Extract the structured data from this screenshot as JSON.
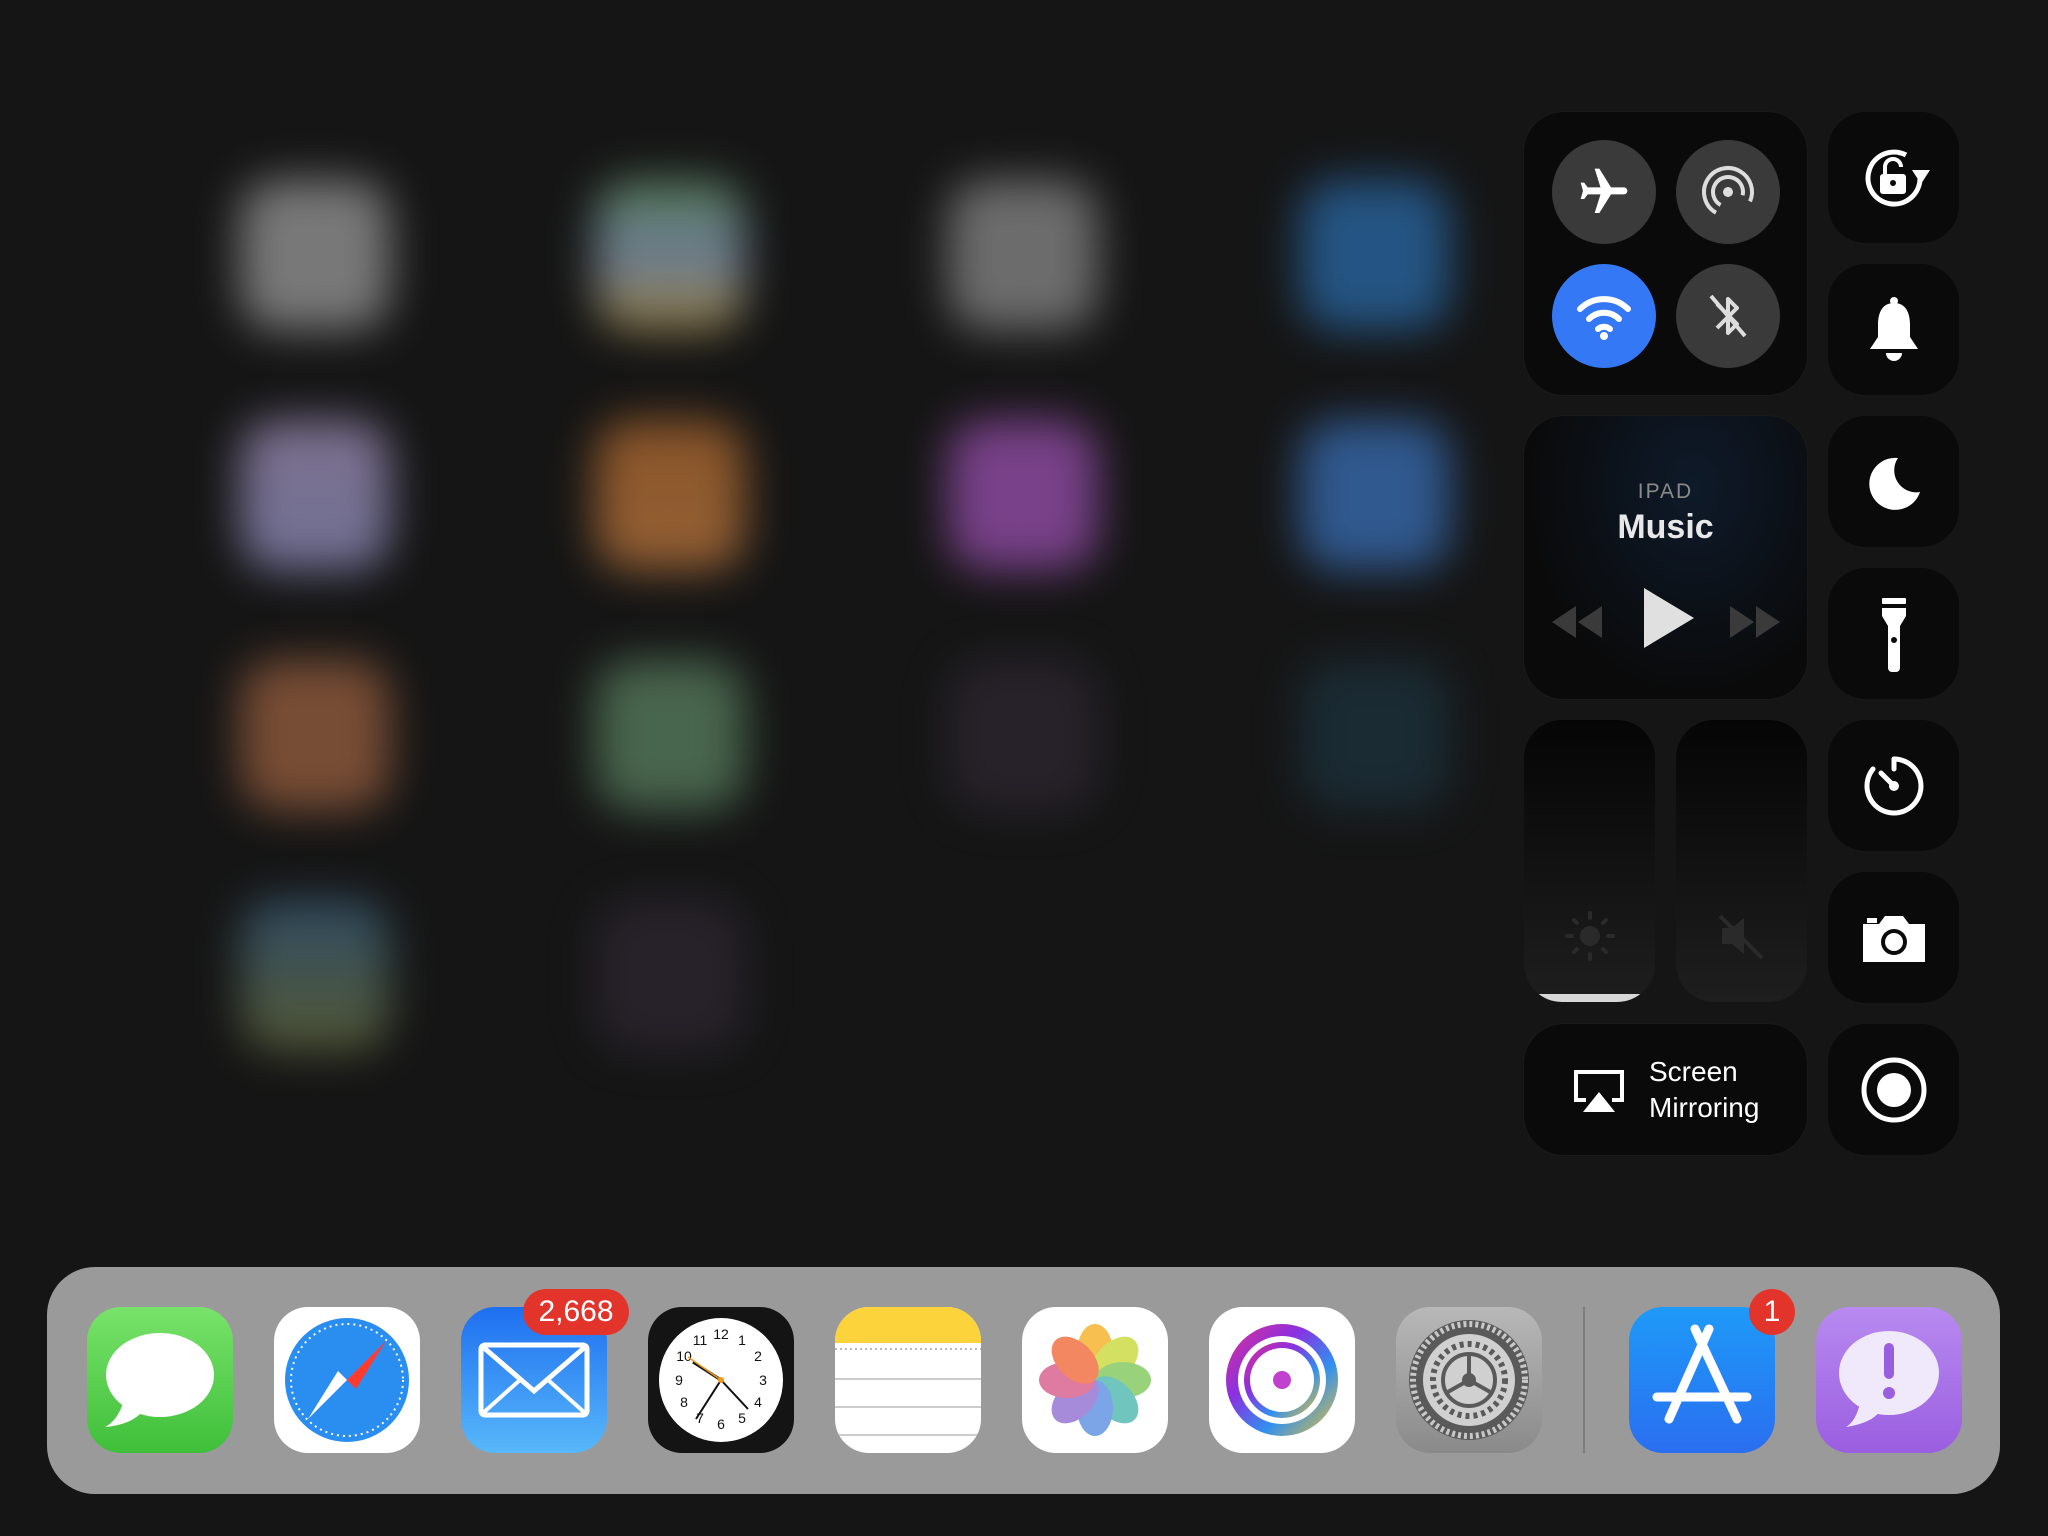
{
  "control_center": {
    "connectivity": {
      "airplane": {
        "icon": "airplane-icon",
        "on": false
      },
      "airdrop": {
        "icon": "airdrop-icon",
        "on": false
      },
      "wifi": {
        "icon": "wifi-icon",
        "on": true
      },
      "bluetooth": {
        "icon": "bluetooth-off-icon",
        "on": false
      }
    },
    "music": {
      "source": "IPAD",
      "title": "Music",
      "controls": [
        "rewind-icon",
        "play-icon",
        "fast-forward-icon"
      ]
    },
    "brightness": {
      "icon": "brightness-icon",
      "level": 0.03
    },
    "volume": {
      "icon": "mute-icon",
      "level": 0.0
    },
    "screen_mirroring": {
      "line1": "Screen",
      "line2": "Mirroring",
      "icon": "airplay-icon"
    },
    "side_buttons": [
      {
        "name": "orientation-lock",
        "icon": "rotation-lock-icon"
      },
      {
        "name": "silent-mode",
        "icon": "bell-icon"
      },
      {
        "name": "do-not-disturb",
        "icon": "moon-icon"
      },
      {
        "name": "flashlight",
        "icon": "flashlight-icon"
      },
      {
        "name": "timer",
        "icon": "timer-icon"
      },
      {
        "name": "camera",
        "icon": "camera-icon"
      },
      {
        "name": "screen-recording",
        "icon": "record-icon"
      }
    ],
    "accent": "#3478f6"
  },
  "dock": {
    "apps": [
      {
        "name": "messages",
        "icon": "messages-icon"
      },
      {
        "name": "safari",
        "icon": "safari-icon"
      },
      {
        "name": "mail",
        "icon": "mail-icon",
        "badge": "2,668"
      },
      {
        "name": "clock",
        "icon": "clock-icon",
        "numbers": [
          "12",
          "1",
          "2",
          "3",
          "4",
          "5",
          "6",
          "7",
          "8",
          "9",
          "10",
          "11"
        ]
      },
      {
        "name": "notes",
        "icon": "notes-icon"
      },
      {
        "name": "photos",
        "icon": "photos-icon"
      },
      {
        "name": "music-app",
        "icon": "music-disc-icon"
      },
      {
        "name": "settings",
        "icon": "settings-icon"
      },
      {
        "name": "app-store",
        "icon": "app-store-icon",
        "badge": "1"
      },
      {
        "name": "feedback",
        "icon": "feedback-icon"
      }
    ]
  }
}
